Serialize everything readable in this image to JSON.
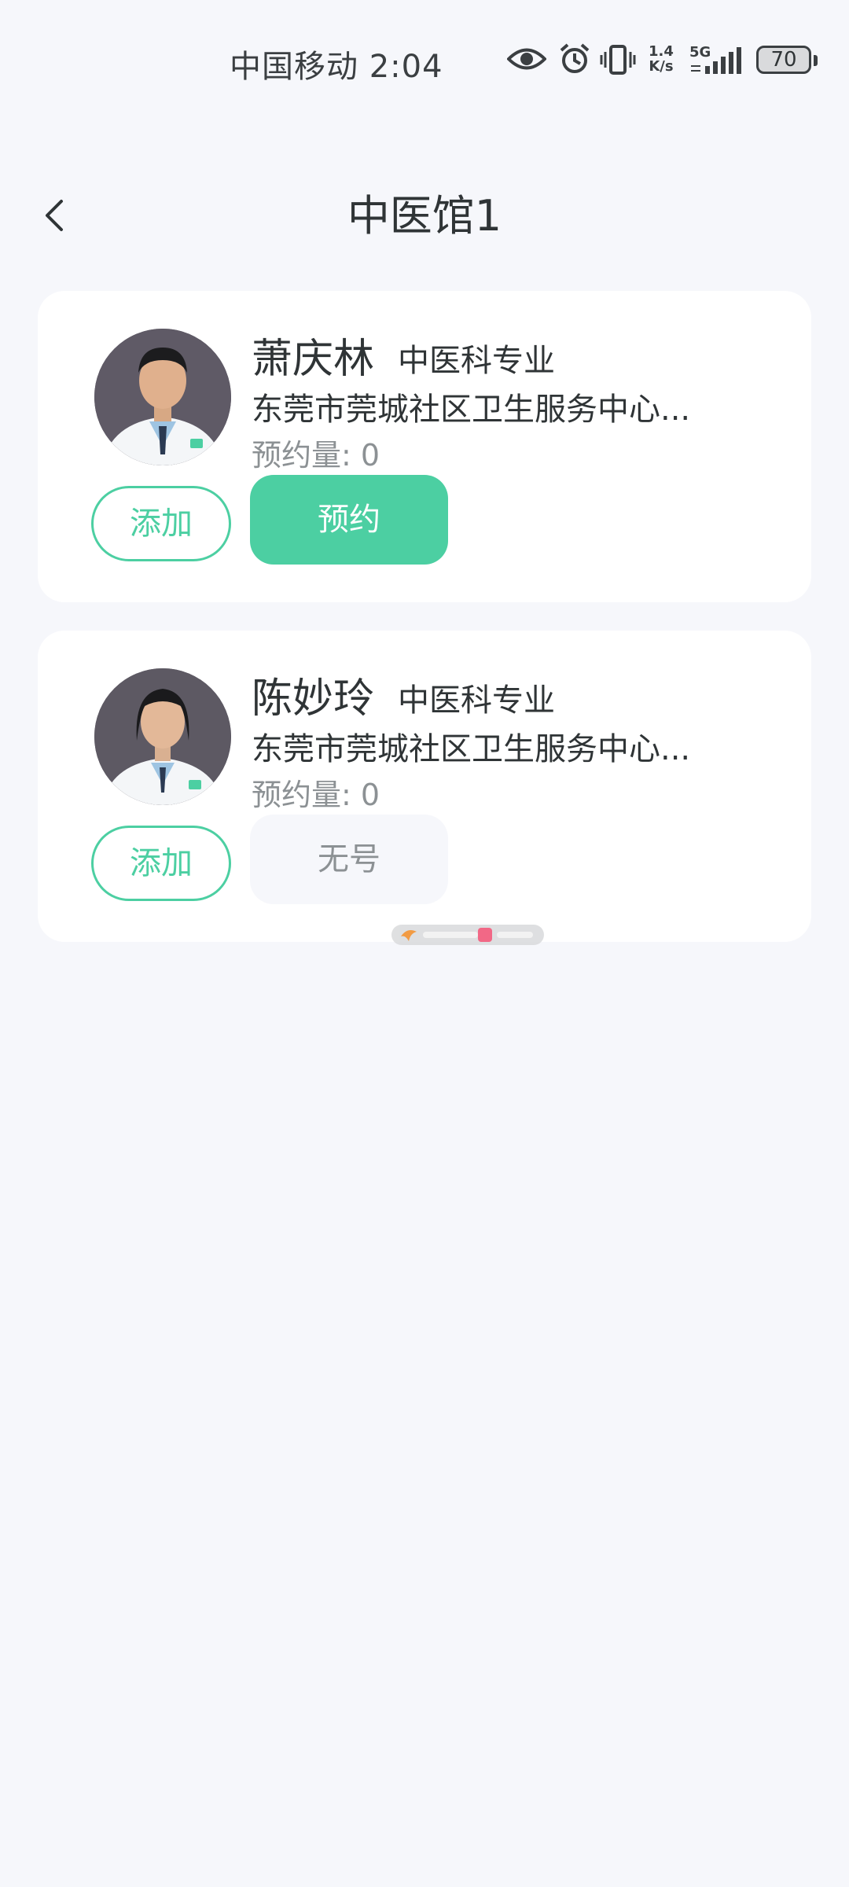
{
  "status_bar": {
    "carrier_time": "中国移动 2:04",
    "net_speed_value": "1.4",
    "net_speed_unit": "K/s",
    "network_type": "5G",
    "battery": "70"
  },
  "header": {
    "title": "中医馆1"
  },
  "doctors": [
    {
      "name": "萧庆林",
      "department": "中医科专业",
      "hospital": "东莞市莞城社区卫生服务中心...",
      "appointment_label": "预约量:",
      "appointment_count": "0",
      "add_label": "添加",
      "action_label": "预约",
      "action_available": true
    },
    {
      "name": "陈妙玲",
      "department": "中医科专业",
      "hospital": "东莞市莞城社区卫生服务中心...",
      "appointment_label": "预约量:",
      "appointment_count": "0",
      "add_label": "添加",
      "action_label": "无号",
      "action_available": false
    }
  ],
  "colors": {
    "accent": "#4ccfa2",
    "background": "#f6f7fb",
    "card": "#ffffff",
    "text_primary": "#2f3436",
    "text_secondary": "#8c9194"
  }
}
